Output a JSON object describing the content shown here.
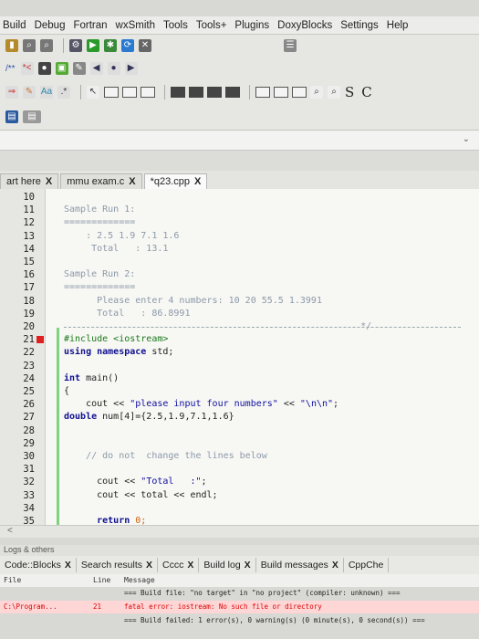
{
  "menu": [
    "Build",
    "Debug",
    "Fortran",
    "wxSmith",
    "Tools",
    "Tools+",
    "Plugins",
    "DoxyBlocks",
    "Settings",
    "Help"
  ],
  "toolbar": {
    "comment_label": "/**",
    "search_glyphs": [
      "S",
      "C"
    ]
  },
  "tabs": [
    {
      "label": "art here",
      "active": false
    },
    {
      "label": "mmu exam.c",
      "active": false
    },
    {
      "label": "*q23.cpp",
      "active": true
    }
  ],
  "editor": {
    "lines": [
      {
        "n": "10",
        "segs": []
      },
      {
        "n": "11",
        "segs": [
          {
            "t": "Sample Run 1:",
            "c": "cm"
          }
        ]
      },
      {
        "n": "12",
        "segs": [
          {
            "t": "=============",
            "c": "cm"
          }
        ]
      },
      {
        "n": "13",
        "segs": [
          {
            "t": "    : 2.5 1.9 7.1 1.6",
            "c": "cm"
          }
        ]
      },
      {
        "n": "14",
        "segs": [
          {
            "t": "     Total   : 13.1",
            "c": "cm"
          }
        ]
      },
      {
        "n": "15",
        "segs": []
      },
      {
        "n": "16",
        "segs": [
          {
            "t": "Sample Run 2:",
            "c": "cm"
          }
        ]
      },
      {
        "n": "17",
        "segs": [
          {
            "t": "=============",
            "c": "cm"
          }
        ]
      },
      {
        "n": "18",
        "segs": [
          {
            "t": "      Please enter 4 numbers: 10 20 55.5 1.3991",
            "c": "cm"
          }
        ]
      },
      {
        "n": "19",
        "segs": [
          {
            "t": "      Total   : 86.8991",
            "c": "cm"
          }
        ]
      },
      {
        "n": "20",
        "segs": [
          {
            "t": "                                                      */",
            "c": "cm"
          }
        ]
      },
      {
        "n": "21",
        "segs": [
          {
            "t": "#include <iostream>",
            "c": "pp"
          }
        ]
      },
      {
        "n": "22",
        "segs": [
          {
            "t": "using namespace",
            "c": "kw"
          },
          {
            "t": " std;",
            "c": ""
          }
        ]
      },
      {
        "n": "23",
        "segs": []
      },
      {
        "n": "24",
        "segs": [
          {
            "t": "int",
            "c": "kw"
          },
          {
            "t": " main()",
            "c": ""
          }
        ]
      },
      {
        "n": "25",
        "segs": [
          {
            "t": "{",
            "c": ""
          }
        ]
      },
      {
        "n": "26",
        "segs": [
          {
            "t": "    cout << ",
            "c": ""
          },
          {
            "t": "\"please input four numbers\"",
            "c": "str"
          },
          {
            "t": " << ",
            "c": ""
          },
          {
            "t": "\"\\n\\n\"",
            "c": "str"
          },
          {
            "t": ";",
            "c": ""
          }
        ]
      },
      {
        "n": "27",
        "segs": [
          {
            "t": "double",
            "c": "kw"
          },
          {
            "t": " num[4]={2.5,1.9,7.1,1.6}",
            "c": ""
          }
        ]
      },
      {
        "n": "28",
        "segs": []
      },
      {
        "n": "29",
        "segs": []
      },
      {
        "n": "30",
        "segs": [
          {
            "t": "    // do not  change the lines below",
            "c": "cm"
          }
        ]
      },
      {
        "n": "31",
        "segs": []
      },
      {
        "n": "32",
        "segs": [
          {
            "t": "      cout << ",
            "c": ""
          },
          {
            "t": "\"Total   :\"",
            "c": "str"
          },
          {
            "t": ";",
            "c": ""
          }
        ]
      },
      {
        "n": "33",
        "segs": [
          {
            "t": "      cout << total << endl;",
            "c": ""
          }
        ]
      },
      {
        "n": "34",
        "segs": []
      },
      {
        "n": "35",
        "segs": [
          {
            "t": "      ",
            "c": ""
          },
          {
            "t": "return",
            "c": "kw"
          },
          {
            "t": " 0;",
            "c": "nm"
          }
        ]
      }
    ]
  },
  "logs": {
    "title": "Logs & others",
    "tabs": [
      "Code::Blocks",
      "Search results",
      "Cccc",
      "Build log",
      "Build messages",
      "CppChe"
    ],
    "columns": [
      "File",
      "Line",
      "Message"
    ],
    "rows": [
      {
        "file": "",
        "line": "",
        "msg": "=== Build file: \"no target\" in \"no project\" (compiler: unknown) ===",
        "error": false
      },
      {
        "file": "C:\\Program...",
        "line": "21",
        "msg": "fatal error: iostream: No such file or directory",
        "error": true
      },
      {
        "file": "",
        "line": "",
        "msg": "=== Build failed: 1 error(s), 0 warning(s) (0 minute(s), 0 second(s)) ===",
        "error": false
      }
    ]
  },
  "colors": {
    "error_bg": "#ffd6d6",
    "error_text": "#dd0000",
    "comment": "#8c9aa8"
  }
}
